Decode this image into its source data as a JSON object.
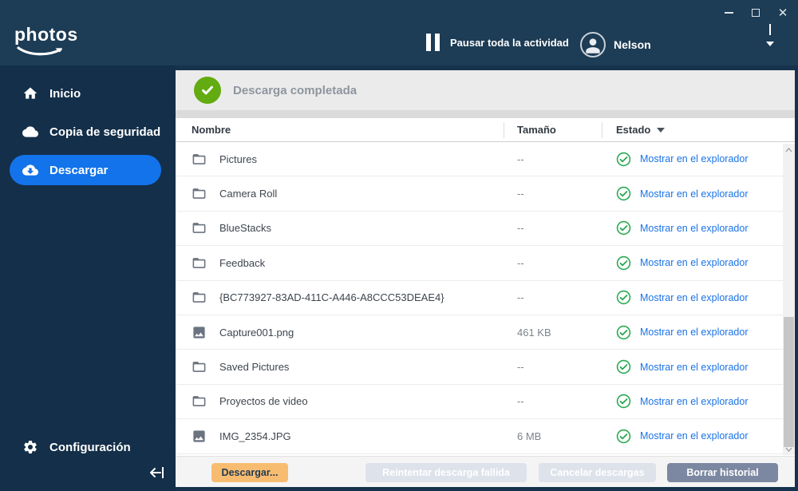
{
  "colors": {
    "topbar": "#1d3c55",
    "sidebar": "#142f49",
    "accent_blue": "#1273eb",
    "link_blue": "#1a73e8",
    "banner_green": "#62ab10",
    "check_green": "#2aa952",
    "download_orange": "#f8bc70",
    "clear_slate": "#7c88a1"
  },
  "topbar": {
    "logo_text": "photos",
    "pause_label": "Pausar toda la actividad",
    "user_name": "Nelson"
  },
  "sidebar": {
    "items": [
      {
        "label": "Inicio"
      },
      {
        "label": "Copia de seguridad"
      },
      {
        "label": "Descargar"
      }
    ],
    "active_item": "Descargar",
    "settings_label": "Configuración"
  },
  "banner": {
    "title": "Descarga completada"
  },
  "table": {
    "headers": {
      "name": "Nombre",
      "size": "Tamaño",
      "status": "Estado"
    },
    "rows": [
      {
        "name": "Pictures",
        "type": "folder",
        "size": "--",
        "action": "Mostrar en el explorador"
      },
      {
        "name": "Camera Roll",
        "type": "folder",
        "size": "--",
        "action": "Mostrar en el explorador"
      },
      {
        "name": "BlueStacks",
        "type": "folder",
        "size": "--",
        "action": "Mostrar en el explorador"
      },
      {
        "name": "Feedback",
        "type": "folder",
        "size": "--",
        "action": "Mostrar en el explorador"
      },
      {
        "name": "{BC773927-83AD-411C-A446-A8CCC53DEAE4}",
        "type": "folder",
        "size": "--",
        "action": "Mostrar en el explorador"
      },
      {
        "name": "Capture001.png",
        "type": "image",
        "size": "461 KB",
        "action": "Mostrar en el explorador"
      },
      {
        "name": "Saved Pictures",
        "type": "folder",
        "size": "--",
        "action": "Mostrar en el explorador"
      },
      {
        "name": "Proyectos de video",
        "type": "folder",
        "size": "--",
        "action": "Mostrar en el explorador"
      },
      {
        "name": "IMG_2354.JPG",
        "type": "image",
        "size": "6 MB",
        "action": "Mostrar en el explorador"
      }
    ]
  },
  "footer": {
    "download": "Descargar...",
    "retry": "Reintentar descarga fallida",
    "cancel": "Cancelar descargas",
    "clear": "Borrar historial"
  }
}
